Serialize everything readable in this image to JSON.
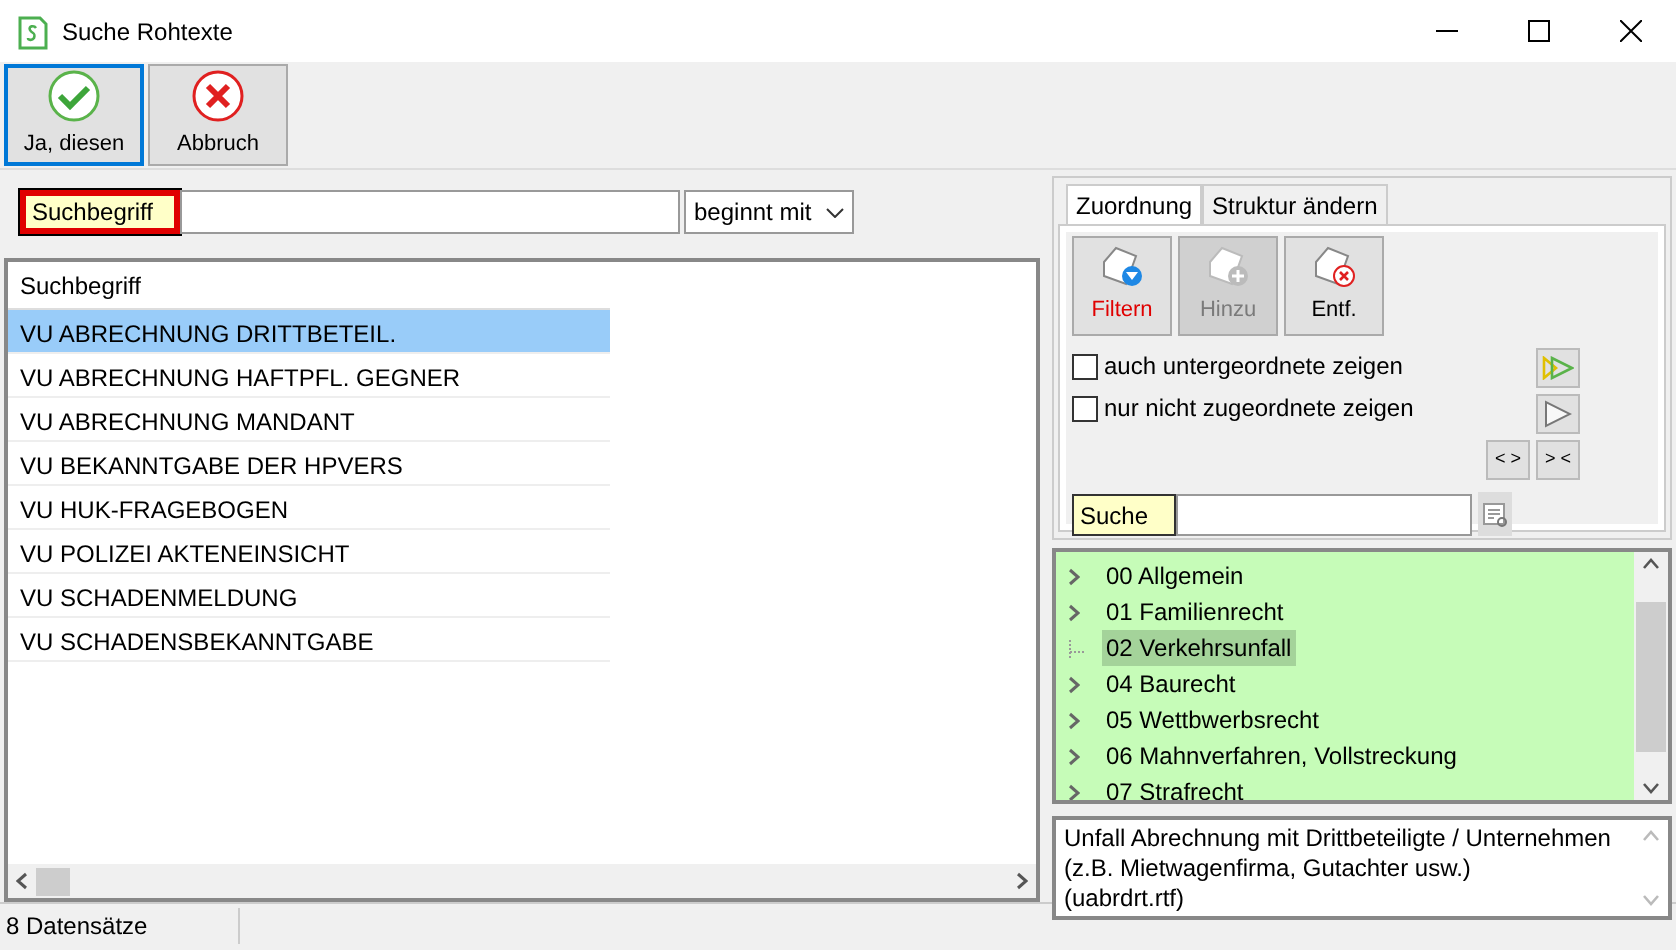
{
  "window": {
    "title": "Suche Rohtexte"
  },
  "toolbar": [
    {
      "label": "Ja, diesen",
      "kind": "ok",
      "focused": true
    },
    {
      "label": "Abbruch",
      "kind": "cancel",
      "focused": false
    }
  ],
  "search": {
    "label": "Suchbegriff",
    "mode": "beginnt mit"
  },
  "table": {
    "columns": [
      "Suchbegriff"
    ],
    "rows": [
      {
        "text": "VU ABRECHNUNG DRITTBETEIL.",
        "selected": true
      },
      {
        "text": "VU ABRECHNUNG HAFTPFL. GEGNER",
        "selected": false
      },
      {
        "text": "VU ABRECHNUNG MANDANT",
        "selected": false
      },
      {
        "text": "VU BEKANNTGABE DER HPVERS",
        "selected": false
      },
      {
        "text": "VU HUK-FRAGEBOGEN",
        "selected": false
      },
      {
        "text": "VU POLIZEI AKTENEINSICHT",
        "selected": false
      },
      {
        "text": "VU SCHADENMELDUNG",
        "selected": false
      },
      {
        "text": "VU SCHADENSBEKANNTGABE",
        "selected": false
      }
    ]
  },
  "tabs": [
    {
      "label": "Zuordnung",
      "selected": true
    },
    {
      "label": "Struktur ändern",
      "selected": false
    }
  ],
  "actions": [
    {
      "label": "Filtern",
      "kind": "filter",
      "disabled": false
    },
    {
      "label": "Hinzu",
      "kind": "add",
      "disabled": true
    },
    {
      "label": "Entf.",
      "kind": "remove",
      "disabled": false
    }
  ],
  "options": [
    {
      "label": "auch untergeordnete zeigen",
      "checked": false
    },
    {
      "label": "nur nicht zugeordnete zeigen",
      "checked": false
    }
  ],
  "nav_buttons": [
    "< >",
    "> <"
  ],
  "tree_search": {
    "label": "Suche"
  },
  "tree": [
    {
      "label": "00 Allgemein",
      "expandable": true,
      "selected": false
    },
    {
      "label": "01 Familienrecht",
      "expandable": true,
      "selected": false
    },
    {
      "label": "02 Verkehrsunfall",
      "expandable": false,
      "selected": true
    },
    {
      "label": "04 Baurecht",
      "expandable": true,
      "selected": false
    },
    {
      "label": "05 Wettbwerbsrecht",
      "expandable": true,
      "selected": false
    },
    {
      "label": "06 Mahnverfahren, Vollstreckung",
      "expandable": true,
      "selected": false
    },
    {
      "label": "07 Strafrecht",
      "expandable": true,
      "selected": false
    }
  ],
  "description": [
    "Unfall Abrechnung mit Drittbeteiligte / Unternehmen",
    "(z.B. Mietwagenfirma, Gutachter usw.)",
    "(uabrdrt.rtf)"
  ],
  "status_bar": "8 Datensätze"
}
